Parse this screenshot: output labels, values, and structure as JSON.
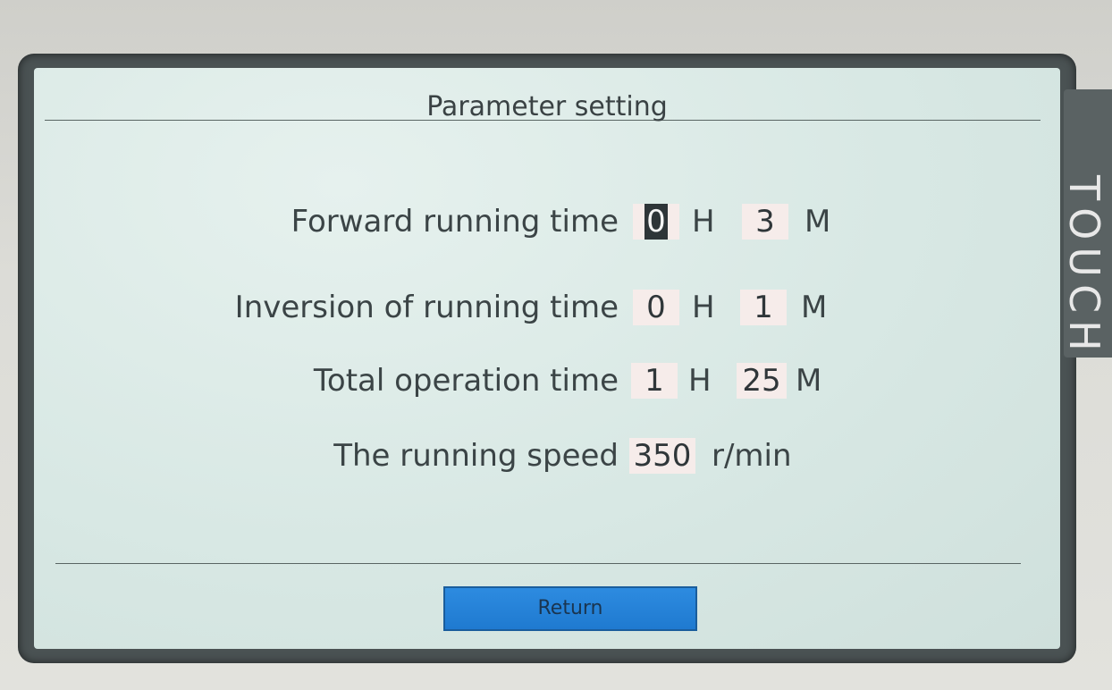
{
  "screen": {
    "title": "Parameter setting",
    "side_label": "TOUCH"
  },
  "params": [
    {
      "label": "Forward running time",
      "hours": "0",
      "hour_unit": "H",
      "minutes": "3",
      "minute_unit": "M"
    },
    {
      "label": "Inversion of running time",
      "hours": "0",
      "hour_unit": "H",
      "minutes": "1",
      "minute_unit": "M"
    },
    {
      "label": "Total operation time",
      "hours": "1",
      "hour_unit": "H",
      "minutes": "25",
      "minute_unit": "M"
    }
  ],
  "speed": {
    "label": "The running speed",
    "value": "350",
    "unit": "r/min"
  },
  "footer": {
    "return_label": "Return"
  },
  "colors": {
    "screen_bg": "#d8e8e4",
    "value_box": "#f6ecea",
    "button": "#2d8be0"
  }
}
